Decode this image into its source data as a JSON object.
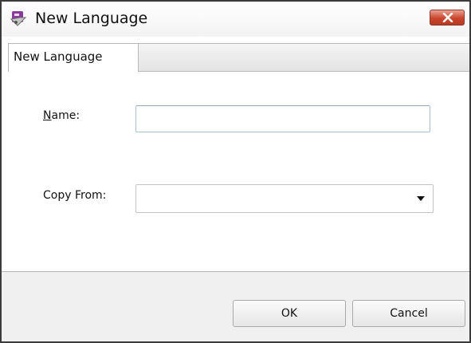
{
  "window": {
    "title": "New Language",
    "close_icon": "close-icon",
    "app_icon": "language-app-icon"
  },
  "tabs": [
    {
      "label": "New Language",
      "selected": true
    }
  ],
  "form": {
    "name_label": "Name:",
    "name_mnemonic": "N",
    "name_label_rest": "ame:",
    "name_value": "",
    "copy_from_label": "Copy From:",
    "copy_from_value": ""
  },
  "buttons": {
    "ok_label": "OK",
    "cancel_label": "Cancel"
  },
  "colors": {
    "close_button": "#c9462d",
    "input_border": "#a9bfd6"
  }
}
